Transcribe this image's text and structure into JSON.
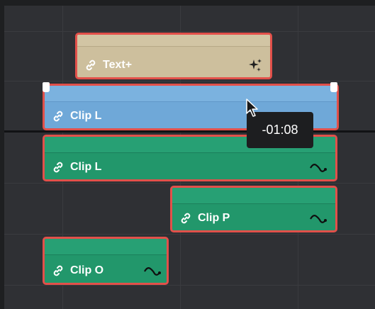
{
  "clips": {
    "text_plus": {
      "label": "Text+",
      "icon": "sparkle-icon"
    },
    "clip_l_blue": {
      "label": "Clip L",
      "icon": "link-icon"
    },
    "clip_l_green": {
      "label": "Clip L",
      "icon": "link-icon",
      "right_icon": "audio-curve-icon"
    },
    "clip_p": {
      "label": "Clip P",
      "icon": "link-icon",
      "right_icon": "audio-curve-icon"
    },
    "clip_o": {
      "label": "Clip O",
      "icon": "link-icon",
      "right_icon": "audio-curve-icon"
    }
  },
  "tooltip": {
    "timecode": "-01:08"
  },
  "colors": {
    "selection_border": "#e2504a",
    "text_clip": "#cdbf9d",
    "blue_clip": "#6fa8d8",
    "green_clip": "#22976b"
  }
}
